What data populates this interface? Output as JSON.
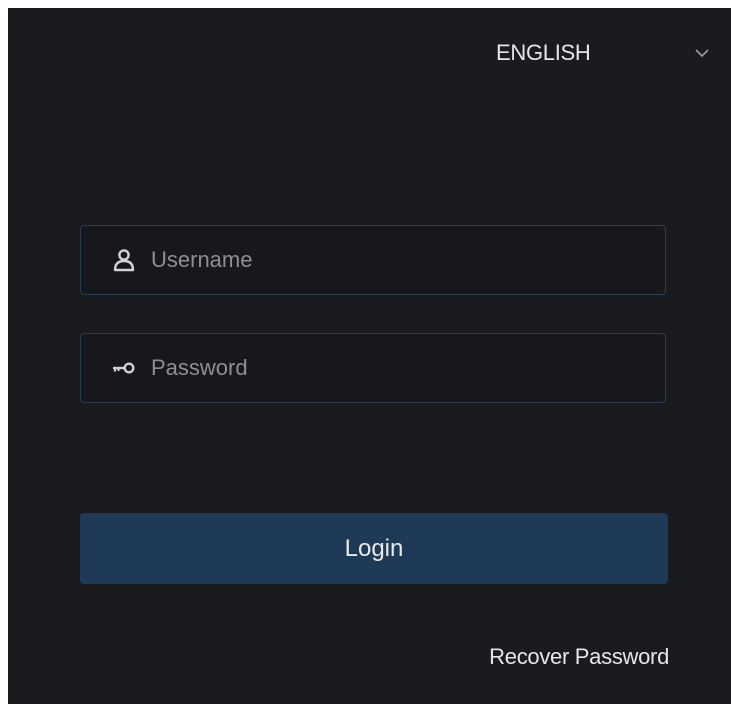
{
  "language": {
    "selected": "ENGLISH",
    "chevron_icon": "chevron-down-icon"
  },
  "username": {
    "placeholder": "Username",
    "value": "",
    "icon": "user-icon"
  },
  "password": {
    "placeholder": "Password",
    "value": "",
    "icon": "key-icon"
  },
  "login": {
    "label": "Login"
  },
  "recover": {
    "label": "Recover Password"
  },
  "colors": {
    "background": "#1a1b1f",
    "field_border": "#2d3d51",
    "button": "#1e3a56",
    "text": "#e6e6e6",
    "placeholder": "#8c8f96"
  }
}
